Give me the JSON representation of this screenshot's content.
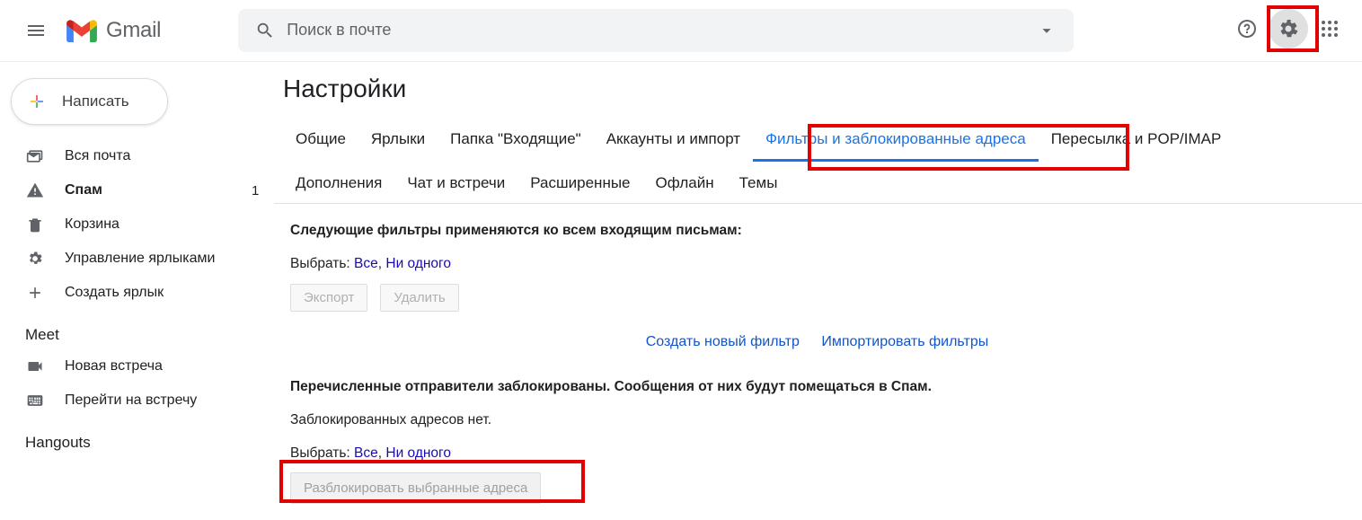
{
  "header": {
    "logo_text": "Gmail",
    "search_placeholder": "Поиск в почте"
  },
  "compose_label": "Написать",
  "sidebar": {
    "items": [
      {
        "label": "Вся почта",
        "bold": false
      },
      {
        "label": "Спам",
        "bold": true,
        "count": "1"
      },
      {
        "label": "Корзина",
        "bold": false
      },
      {
        "label": "Управление ярлыками",
        "bold": false
      },
      {
        "label": "Создать ярлык",
        "bold": false
      }
    ],
    "meet_title": "Meet",
    "meet_items": [
      {
        "label": "Новая встреча"
      },
      {
        "label": "Перейти на встречу"
      }
    ],
    "hangouts_title": "Hangouts"
  },
  "settings_title": "Настройки",
  "tabs_row1": [
    "Общие",
    "Ярлыки",
    "Папка \"Входящие\"",
    "Аккаунты и импорт",
    "Фильтры и заблокированные адреса",
    "Пересылка и POP/IMAP"
  ],
  "tabs_row2": [
    "Дополнения",
    "Чат и встречи",
    "Расширенные",
    "Офлайн",
    "Темы"
  ],
  "active_tab": "Фильтры и заблокированные адреса",
  "pane": {
    "filters_heading": "Следующие фильтры применяются ко всем входящим письмам:",
    "select_prefix": "Выбрать: ",
    "select_all": "Все",
    "select_none": "Ни одного",
    "comma": ", ",
    "btn_export": "Экспорт",
    "btn_delete": "Удалить",
    "link_create_filter": "Создать новый фильтр",
    "link_import_filters": "Импортировать фильтры",
    "blocked_heading": "Перечисленные отправители заблокированы. Сообщения от них будут помещаться в Спам.",
    "blocked_status": "Заблокированных адресов нет.",
    "btn_unblock": "Разблокировать выбранные адреса"
  }
}
